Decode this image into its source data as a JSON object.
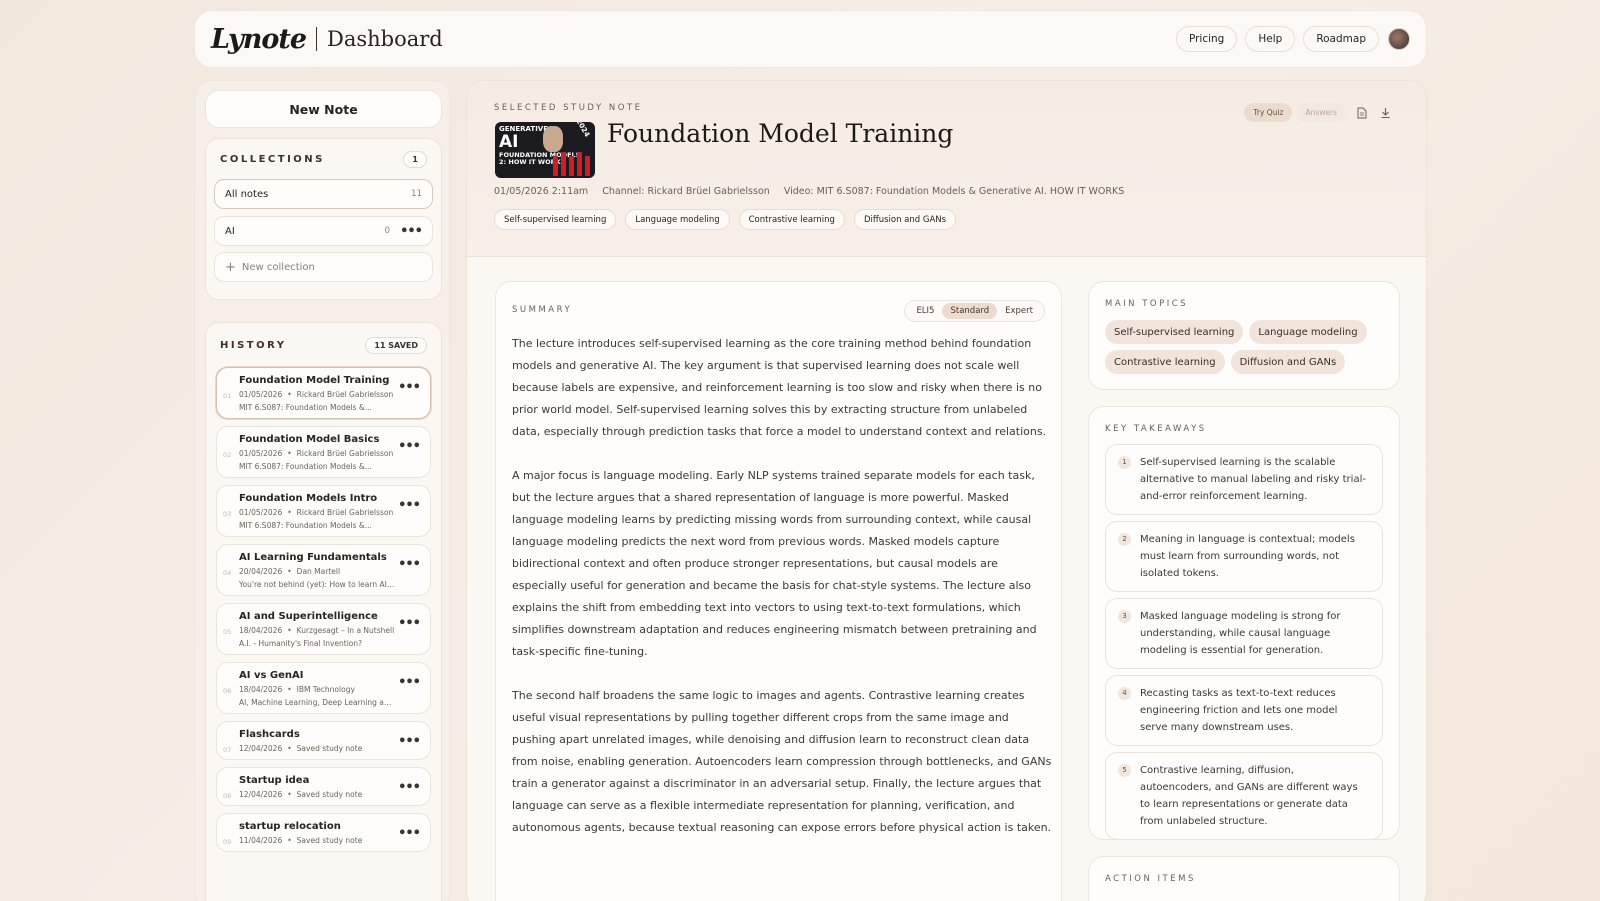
{
  "header": {
    "logo": "Lynote",
    "page_title": "Dashboard",
    "nav": [
      "Pricing",
      "Help",
      "Roadmap"
    ]
  },
  "sidebar": {
    "new_note": "New Note",
    "collections": {
      "title": "COLLECTIONS",
      "count": "1",
      "items": [
        {
          "label": "All notes",
          "count": "11"
        },
        {
          "label": "AI",
          "count": "0"
        }
      ],
      "new_label": "New collection"
    },
    "history": {
      "title": "HISTORY",
      "badge": "11 SAVED",
      "items": [
        {
          "num": "01",
          "title": "Foundation Model Training",
          "date": "01/05/2026",
          "source": "Rickard Brüel Gabrielsson",
          "desc": "MIT 6.S087: Foundation Models &..."
        },
        {
          "num": "02",
          "title": "Foundation Model Basics",
          "date": "01/05/2026",
          "source": "Rickard Brüel Gabrielsson",
          "desc": "MIT 6.S087: Foundation Models &..."
        },
        {
          "num": "03",
          "title": "Foundation Models Intro",
          "date": "01/05/2026",
          "source": "Rickard Brüel Gabrielsson",
          "desc": "MIT 6.S087: Foundation Models &..."
        },
        {
          "num": "04",
          "title": "AI Learning Fundamentals",
          "date": "20/04/2026",
          "source": "Dan Martell",
          "desc": "You're not behind (yet): How to learn AI i..."
        },
        {
          "num": "05",
          "title": "AI and Superintelligence",
          "date": "18/04/2026",
          "source": "Kurzgesagt – In a Nutshell",
          "desc": "A.I. - Humanity's Final Invention?"
        },
        {
          "num": "06",
          "title": "AI vs GenAI",
          "date": "18/04/2026",
          "source": "IBM Technology",
          "desc": "AI, Machine Learning, Deep Learning and..."
        },
        {
          "num": "07",
          "title": "Flashcards",
          "date": "12/04/2026",
          "source": "Saved study note",
          "desc": ""
        },
        {
          "num": "08",
          "title": "Startup idea",
          "date": "12/04/2026",
          "source": "Saved study note",
          "desc": ""
        },
        {
          "num": "09",
          "title": "startup relocation",
          "date": "11/04/2026",
          "source": "Saved study note",
          "desc": ""
        }
      ]
    }
  },
  "note": {
    "eyebrow": "SELECTED STUDY NOTE",
    "title": "Foundation Model Training",
    "thumb": {
      "line1": "GENERATIVE",
      "line2": "AI",
      "line3": "FOUNDATION MODELS",
      "line4": "2: HOW IT WORKS",
      "year": "2024"
    },
    "meta": {
      "date": "01/05/2026 2:11am",
      "channel": "Channel: Rickard Brüel Gabrielsson",
      "video": "Video: MIT 6.S087: Foundation Models & Generative AI. HOW IT WORKS"
    },
    "tags": [
      "Self-supervised learning",
      "Language modeling",
      "Contrastive learning",
      "Diffusion and GANs"
    ],
    "actions": {
      "try_quiz": "Try Quiz",
      "answers": "Answers"
    }
  },
  "summary": {
    "title": "SUMMARY",
    "modes": [
      "ELI5",
      "Standard",
      "Expert"
    ],
    "selected_mode": "Standard",
    "paragraphs": [
      "The lecture introduces self-supervised learning as the core training method behind foundation models and generative AI. The key argument is that supervised learning does not scale well because labels are expensive, and reinforcement learning is too slow and risky when there is no prior world model. Self-supervised learning solves this by extracting structure from unlabeled data, especially through prediction tasks that force a model to understand context and relations.",
      "A major focus is language modeling. Early NLP systems trained separate models for each task, but the lecture argues that a shared representation of language is more powerful. Masked language modeling learns by predicting missing words from surrounding context, while causal language modeling predicts the next word from previous words. Masked models capture bidirectional context and often produce stronger representations, but causal models are especially useful for generation and became the basis for chat-style systems. The lecture also explains the shift from embedding text into vectors to using text-to-text formulations, which simplifies downstream adaptation and reduces engineering mismatch between pretraining and task-specific fine-tuning.",
      "The second half broadens the same logic to images and agents. Contrastive learning creates useful visual representations by pulling together different crops from the same image and pushing apart unrelated images, while denoising and diffusion learn to reconstruct clean data from noise, enabling generation. Autoencoders learn compression through bottlenecks, and GANs train a generator against a discriminator in an adversarial setup. Finally, the lecture argues that language can serve as a flexible intermediate representation for planning, verification, and autonomous agents, because textual reasoning can expose errors before physical action is taken."
    ]
  },
  "main_topics": {
    "title": "MAIN TOPICS",
    "items": [
      "Self-supervised learning",
      "Language modeling",
      "Contrastive learning",
      "Diffusion and GANs"
    ]
  },
  "key_takeaways": {
    "title": "KEY TAKEAWAYS",
    "items": [
      {
        "n": "1",
        "text": "Self-supervised learning is the scalable alternative to manual labeling and risky trial-and-error reinforcement learning."
      },
      {
        "n": "2",
        "text": "Meaning in language is contextual; models must learn from surrounding words, not isolated tokens."
      },
      {
        "n": "3",
        "text": "Masked language modeling is strong for understanding, while causal language modeling is essential for generation."
      },
      {
        "n": "4",
        "text": "Recasting tasks as text-to-text reduces engineering friction and lets one model serve many downstream uses."
      },
      {
        "n": "5",
        "text": "Contrastive learning, diffusion, autoencoders, and GANs are different ways to learn representations or generate data from unlabeled structure."
      }
    ]
  },
  "action_items": {
    "title": "ACTION ITEMS"
  }
}
